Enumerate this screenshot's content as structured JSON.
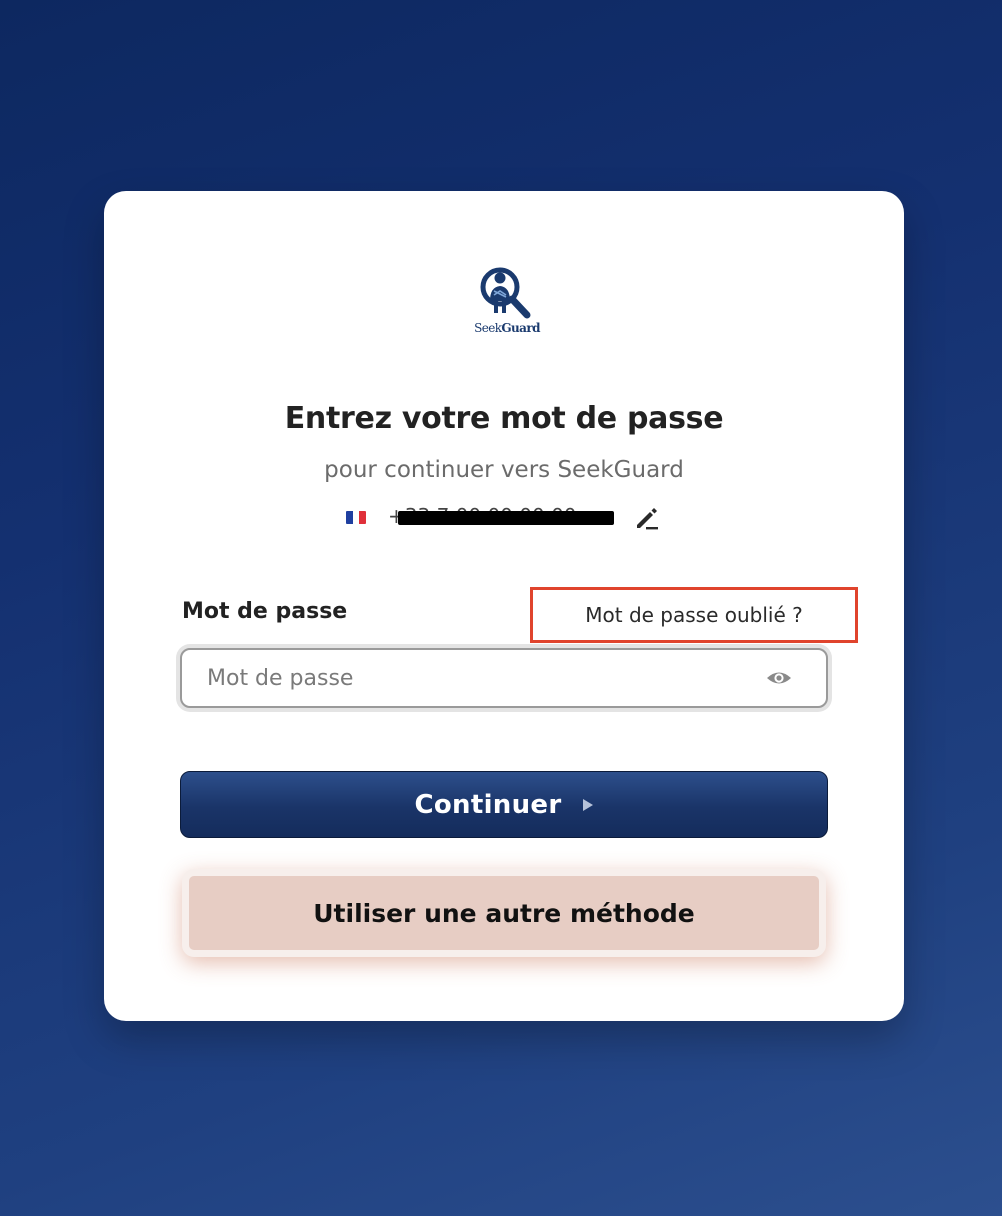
{
  "brand": {
    "name_part1": "Seek",
    "name_part2": "Guard",
    "color": "#1a3a6e"
  },
  "header": {
    "title": "Entrez votre mot de passe",
    "subtitle": "pour continuer vers SeekGuard"
  },
  "account": {
    "country_flag": "france-flag",
    "phone_number": "+33 7 00 00 00 00",
    "phone_redacted": true,
    "edit_icon": "edit-icon"
  },
  "form": {
    "password_label": "Mot de passe",
    "forgot_password_link": "Mot de passe oublié ?",
    "password_placeholder": "Mot de passe",
    "password_value": "",
    "show_password_icon": "eye-icon"
  },
  "actions": {
    "continue_label": "Continuer",
    "alternate_method_label": "Utiliser une autre méthode"
  },
  "colors": {
    "primary": "#1a3468",
    "highlight_border": "#e0442d",
    "secondary_button": "#e7cdc4"
  }
}
